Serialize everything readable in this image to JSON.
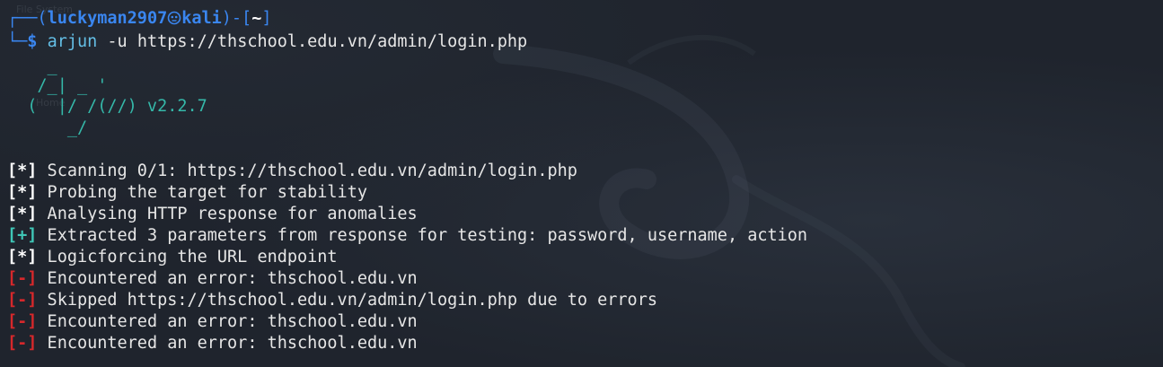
{
  "desktop": {
    "labels": [
      "File System",
      "Home"
    ]
  },
  "prompt": {
    "frame_top_left": "┌──(",
    "user": "luckyman2907",
    "host": "kali",
    "frame_mid": ")-[",
    "cwd": "~",
    "frame_end": "]",
    "frame_bottom": "└─",
    "dollar": "$",
    "command": "arjun",
    "args": " -u https://thschool.edu.vn/admin/login.php"
  },
  "banner": {
    "line1": "    _",
    "line2": "   /_| _ '",
    "line3": "  (  |/ /(//) v2.2.7",
    "line4": "      _/"
  },
  "output": [
    {
      "tag": "[*]",
      "kind": "info",
      "text": " Scanning 0/1: https://thschool.edu.vn/admin/login.php"
    },
    {
      "tag": "[*]",
      "kind": "info",
      "text": " Probing the target for stability"
    },
    {
      "tag": "[*]",
      "kind": "info",
      "text": " Analysing HTTP response for anomalies"
    },
    {
      "tag": "[+]",
      "kind": "ok",
      "text": " Extracted 3 parameters from response for testing: password, username, action"
    },
    {
      "tag": "[*]",
      "kind": "info",
      "text": " Logicforcing the URL endpoint"
    },
    {
      "tag": "[-]",
      "kind": "err",
      "text": " Encountered an error: thschool.edu.vn"
    },
    {
      "tag": "[-]",
      "kind": "err",
      "text": " Skipped https://thschool.edu.vn/admin/login.php due to errors"
    },
    {
      "tag": "[-]",
      "kind": "err",
      "text": " Encountered an error: thschool.edu.vn"
    },
    {
      "tag": "[-]",
      "kind": "err",
      "text": " Encountered an error: thschool.edu.vn"
    }
  ],
  "colors": {
    "background": "#1f242d",
    "prompt_blue": "#3a86f0",
    "banner_teal": "#35b8a9",
    "success_teal": "#3fc6b6",
    "error_red": "#d6282b"
  }
}
